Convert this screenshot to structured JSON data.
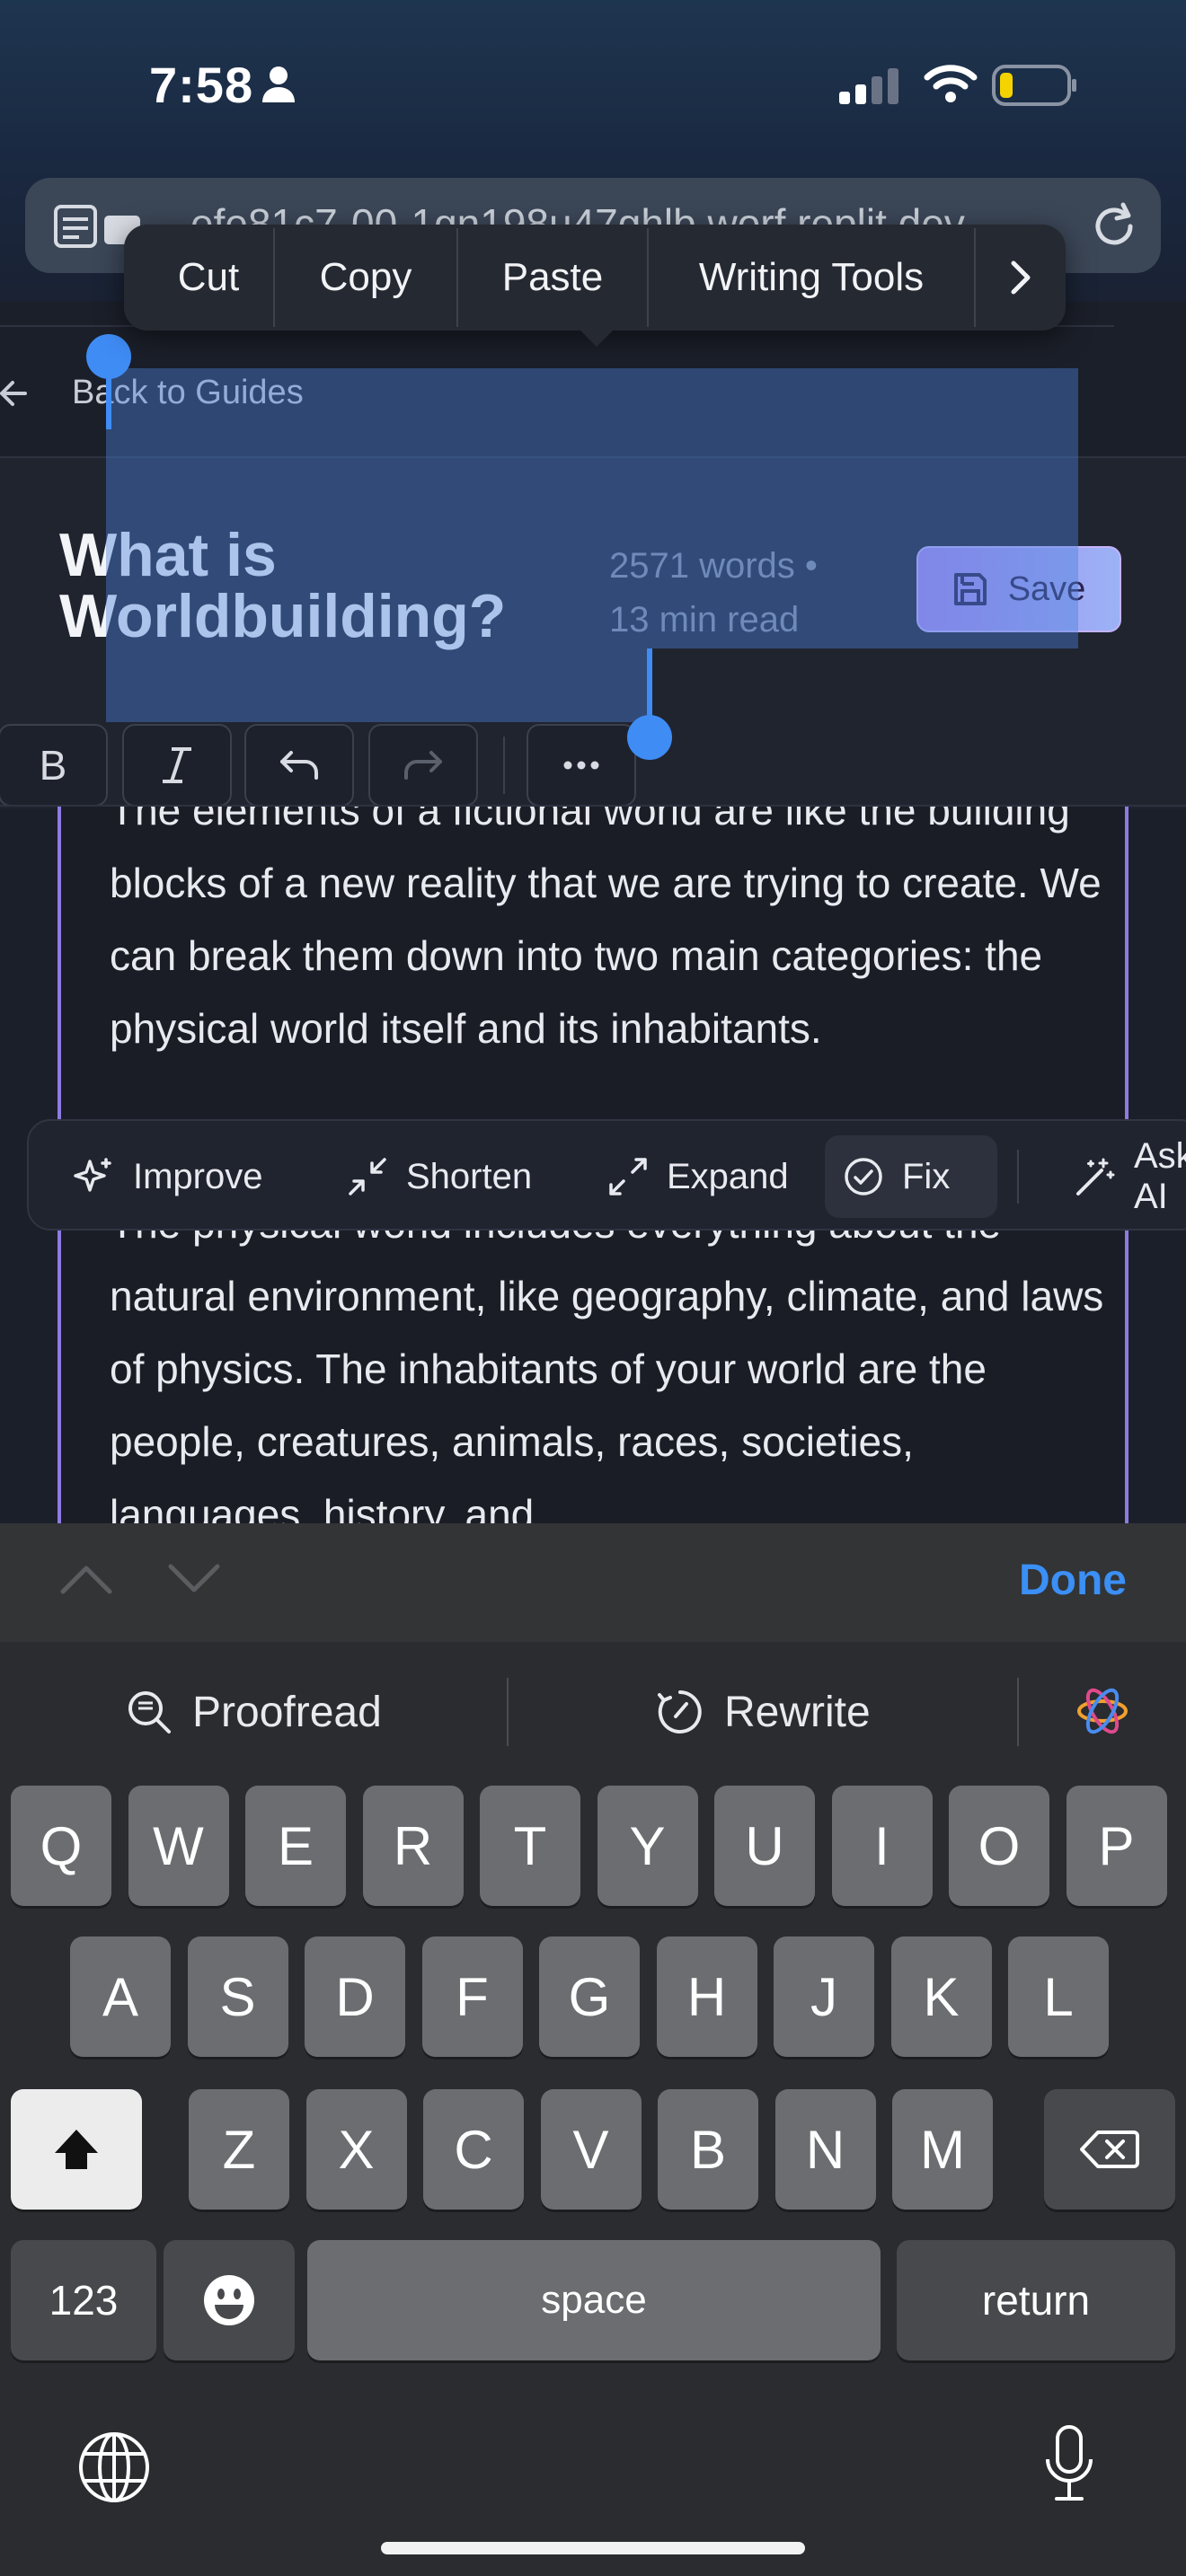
{
  "status_bar": {
    "time": "7:58"
  },
  "browser": {
    "url": "efe81c7-00-1gn198u47ghlb.worf.replit.dev"
  },
  "context_menu": {
    "items": [
      "Cut",
      "Copy",
      "Paste",
      "Writing Tools"
    ]
  },
  "nav": {
    "back_label": "Back to Guides"
  },
  "document": {
    "title": "What is Worldbuilding?",
    "word_count": "2571 words •",
    "read_time": "13 min read",
    "save_label": "Save",
    "paragraphs": [
      "The elements of a fictional world are like the building blocks of a new reality that we are trying to create. We can break them down into two main categories: the physical world itself and its inhabitants.",
      "The physical world includes everything about the natural environment, like geography, climate, and laws of physics. The inhabitants of your world are the people, creatures, animals, races, societies, languages, history, and"
    ]
  },
  "toolbar": {
    "buttons": [
      "bold",
      "italic",
      "undo",
      "redo",
      "more"
    ]
  },
  "ai_actions": {
    "improve": "Improve",
    "shorten": "Shorten",
    "expand": "Expand",
    "fix": "Fix",
    "ask": "Ask AI"
  },
  "keyboard": {
    "done": "Done",
    "proofread": "Proofread",
    "rewrite": "Rewrite",
    "row1": [
      "Q",
      "W",
      "E",
      "R",
      "T",
      "Y",
      "U",
      "I",
      "O",
      "P"
    ],
    "row2": [
      "A",
      "S",
      "D",
      "F",
      "G",
      "H",
      "J",
      "K",
      "L"
    ],
    "row3": [
      "Z",
      "X",
      "C",
      "V",
      "B",
      "N",
      "M"
    ],
    "numbers": "123",
    "space": "space",
    "return": "return"
  },
  "colors": {
    "accent": "#3f8cf5",
    "save_gradient_start": "#a98bf2",
    "editor_border": "#8d7be0"
  }
}
